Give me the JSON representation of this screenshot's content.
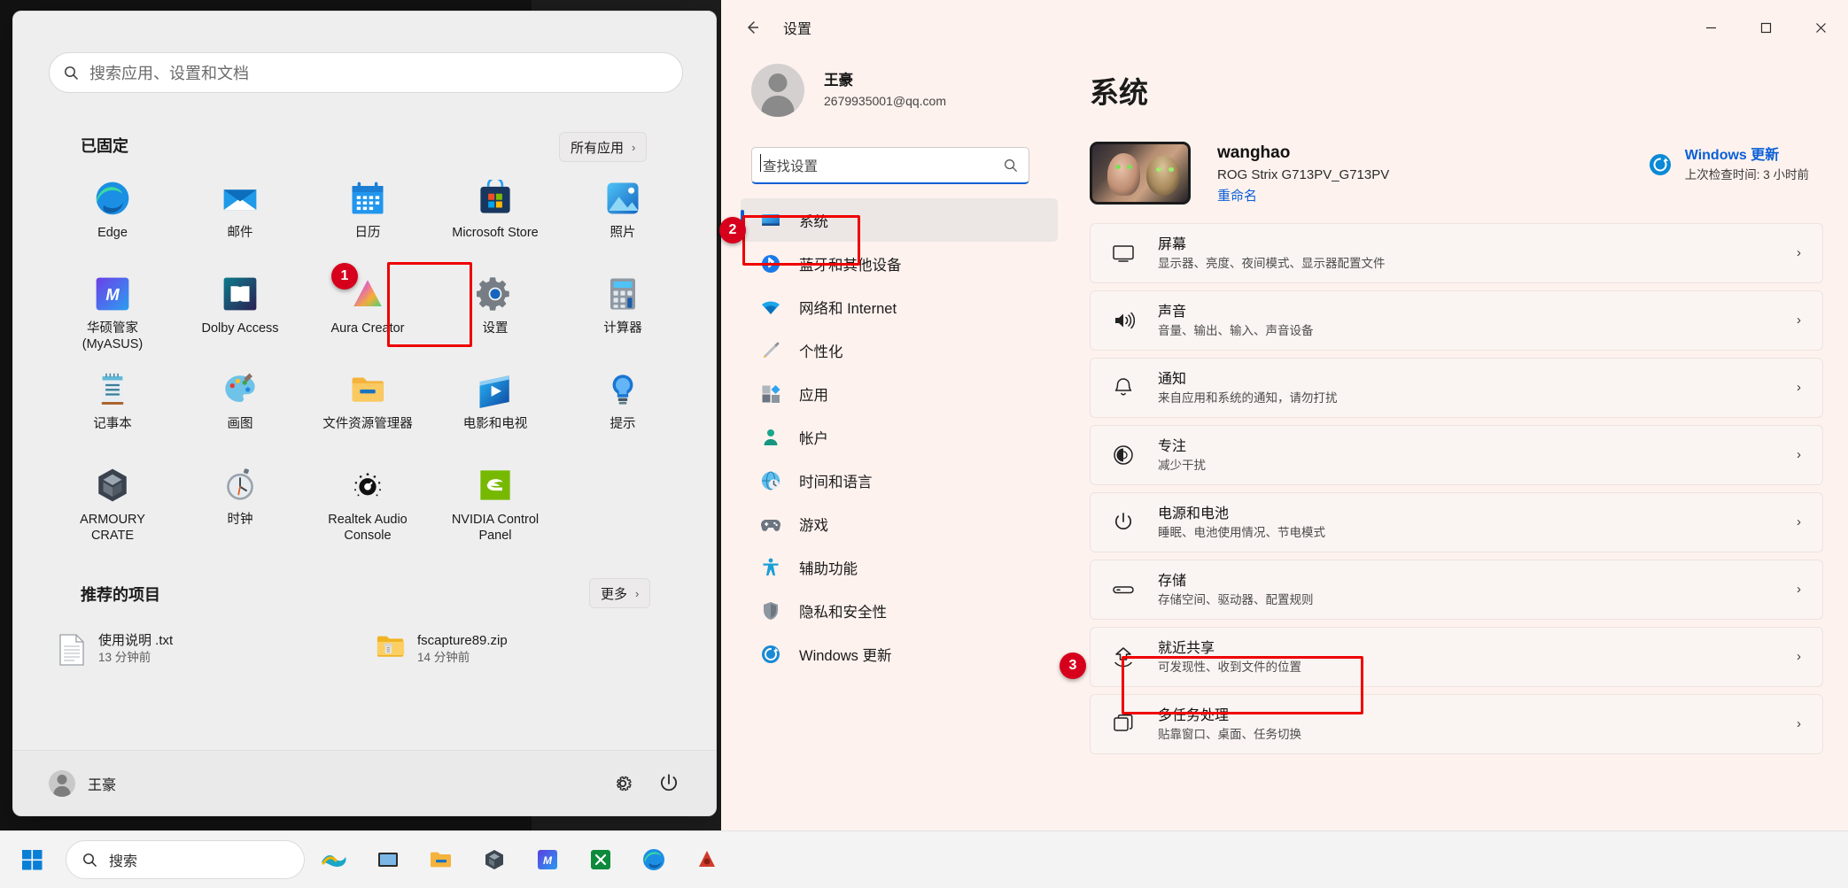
{
  "start_menu": {
    "search_placeholder": "搜索应用、设置和文档",
    "pinned_heading": "已固定",
    "all_apps_label": "所有应用",
    "all_apps_chevron": "›",
    "pinned_apps": [
      {
        "label": "Edge",
        "icon": "edge-icon"
      },
      {
        "label": "邮件",
        "icon": "mail-icon"
      },
      {
        "label": "日历",
        "icon": "calendar-icon"
      },
      {
        "label": "Microsoft Store",
        "icon": "microsoft-store-icon"
      },
      {
        "label": "照片",
        "icon": "photos-icon"
      },
      {
        "label": "华硕管家\n(MyASUS)",
        "icon": "myasus-icon"
      },
      {
        "label": "Dolby Access",
        "icon": "dolby-access-icon"
      },
      {
        "label": "Aura Creator",
        "icon": "aura-creator-icon"
      },
      {
        "label": "设置",
        "icon": "settings-gear-icon"
      },
      {
        "label": "计算器",
        "icon": "calculator-icon"
      },
      {
        "label": "记事本",
        "icon": "notepad-icon"
      },
      {
        "label": "画图",
        "icon": "paint-icon"
      },
      {
        "label": "文件资源管理器",
        "icon": "file-explorer-icon"
      },
      {
        "label": "电影和电视",
        "icon": "movies-tv-icon"
      },
      {
        "label": "提示",
        "icon": "tips-icon"
      },
      {
        "label": "ARMOURY\nCRATE",
        "icon": "armoury-crate-icon"
      },
      {
        "label": "时钟",
        "icon": "clock-icon"
      },
      {
        "label": "Realtek Audio\nConsole",
        "icon": "realtek-audio-icon"
      },
      {
        "label": "NVIDIA Control\nPanel",
        "icon": "nvidia-icon"
      }
    ],
    "recommended_heading": "推荐的项目",
    "more_label": "更多",
    "more_chevron": "›",
    "recommended": [
      {
        "name": "使用说明 .txt",
        "time": "13 分钟前",
        "icon": "text-file-icon"
      },
      {
        "name": "fscapture89.zip",
        "time": "14 分钟前",
        "icon": "zip-folder-icon"
      }
    ],
    "footer_user": "王豪",
    "footer_settings_icon": "gear-icon",
    "footer_power_icon": "power-icon"
  },
  "settings": {
    "title": "设置",
    "back_icon": "back-arrow-icon",
    "window_controls": {
      "minimize": "—",
      "maximize": "▢",
      "close": "✕"
    },
    "profile": {
      "name": "王豪",
      "email": "2679935001@qq.com"
    },
    "find_placeholder": "查找设置",
    "find_icon": "search-icon",
    "nav_items": [
      {
        "label": "系统",
        "icon": "system-icon",
        "active": true
      },
      {
        "label": "蓝牙和其他设备",
        "icon": "bluetooth-icon",
        "active": false
      },
      {
        "label": "网络和 Internet",
        "icon": "wifi-icon",
        "active": false
      },
      {
        "label": "个性化",
        "icon": "personalization-brush-icon",
        "active": false
      },
      {
        "label": "应用",
        "icon": "apps-icon",
        "active": false
      },
      {
        "label": "帐户",
        "icon": "accounts-person-icon",
        "active": false
      },
      {
        "label": "时间和语言",
        "icon": "time-language-icon",
        "active": false
      },
      {
        "label": "游戏",
        "icon": "gaming-icon",
        "active": false
      },
      {
        "label": "辅助功能",
        "icon": "accessibility-icon",
        "active": false
      },
      {
        "label": "隐私和安全性",
        "icon": "privacy-shield-icon",
        "active": false
      },
      {
        "label": "Windows 更新",
        "icon": "windows-update-icon",
        "active": false
      }
    ],
    "page_title": "系统",
    "device": {
      "name": "wanghao",
      "model": "ROG Strix G713PV_G713PV",
      "rename_label": "重命名",
      "thumbnail_icon": "device-wallpaper-thumbnail"
    },
    "windows_update": {
      "title": "Windows 更新",
      "subtitle": "上次检查时间: 3 小时前",
      "icon": "update-sync-icon"
    },
    "cards": [
      {
        "title": "屏幕",
        "subtitle": "显示器、亮度、夜间模式、显示器配置文件",
        "icon": "display-monitor-icon"
      },
      {
        "title": "声音",
        "subtitle": "音量、输出、输入、声音设备",
        "icon": "sound-speaker-icon"
      },
      {
        "title": "通知",
        "subtitle": "来自应用和系统的通知，请勿打扰",
        "icon": "notification-bell-icon"
      },
      {
        "title": "专注",
        "subtitle": "减少干扰",
        "icon": "focus-icon"
      },
      {
        "title": "电源和电池",
        "subtitle": "睡眠、电池使用情况、节电模式",
        "icon": "power-battery-icon"
      },
      {
        "title": "存储",
        "subtitle": "存储空间、驱动器、配置规则",
        "icon": "storage-drive-icon"
      },
      {
        "title": "就近共享",
        "subtitle": "可发现性、收到文件的位置",
        "icon": "nearby-share-icon"
      },
      {
        "title": "多任务处理",
        "subtitle": "贴靠窗口、桌面、任务切换",
        "icon": "multitasking-icon"
      }
    ],
    "card_chevron": "›"
  },
  "annotations": [
    {
      "number": "1",
      "target": "settings-app-tile"
    },
    {
      "number": "2",
      "target": "nav-item-system"
    },
    {
      "number": "3",
      "target": "card-storage"
    }
  ],
  "taskbar": {
    "start_icon": "windows-start-icon",
    "search_label": "搜索",
    "search_icon": "search-icon",
    "items": [
      {
        "icon": "copilot-icon"
      },
      {
        "icon": "task-view-icon"
      },
      {
        "icon": "file-explorer-icon"
      },
      {
        "icon": "armoury-crate-icon"
      },
      {
        "icon": "myasus-icon"
      },
      {
        "icon": "xbox-icon"
      },
      {
        "icon": "edge-icon"
      },
      {
        "icon": "app-icon"
      }
    ]
  },
  "colors": {
    "accent": "#0a5fd6",
    "annotation": "#ef0000",
    "badge": "#d6001c",
    "settings_bg": "#fdf2ee",
    "start_bg": "#f3f3f3"
  }
}
